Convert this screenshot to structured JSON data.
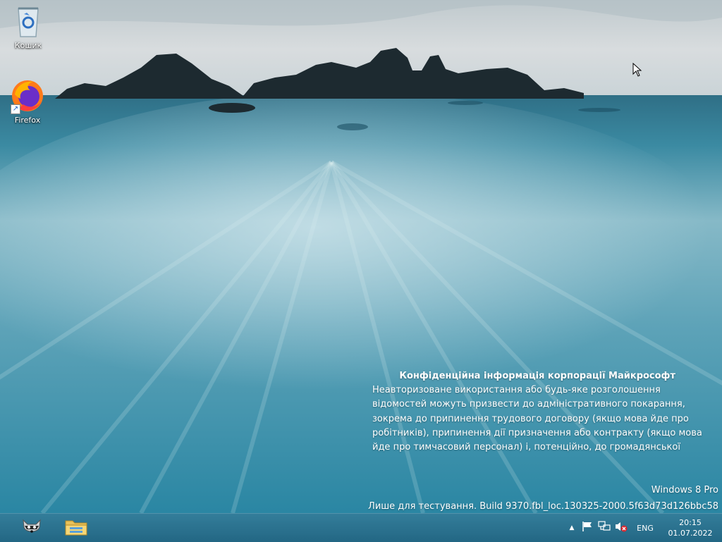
{
  "desktop": {
    "icons": [
      {
        "label": "Кошик",
        "icon": "recycle-bin-icon"
      },
      {
        "label": "Firefox",
        "icon": "firefox-icon"
      }
    ]
  },
  "watermark": {
    "title": "Конфіденційна інформація корпорації Майкрософт",
    "lines": [
      "Неавторизоване використання або будь-яке розголошення",
      "відомостей можуть призвести до адміністративного покарання,",
      "зокрема до припинення трудового договору (якщо мова йде про",
      "робітників), припинення дії призначення або контракту (якщо мова",
      "йде про тимчасовий персонал) і, потенційно, до громадянської"
    ]
  },
  "build": {
    "edition": "Windows 8 Pro",
    "info": "Лише для тестування. Build 9370.fbl_loc.130325-2000.5f63d73d126bbc58"
  },
  "taskbar": {
    "pinned": [
      {
        "icon": "raccoon-app-icon"
      },
      {
        "icon": "file-explorer-icon"
      }
    ],
    "tray": {
      "show_hidden_icon": "chevron-up-icon",
      "action_center_icon": "flag-icon",
      "network_icon": "network-icon",
      "volume_icon": "volume-muted-icon",
      "language": "ENG",
      "time": "20:15",
      "date": "01.07.2022"
    }
  }
}
